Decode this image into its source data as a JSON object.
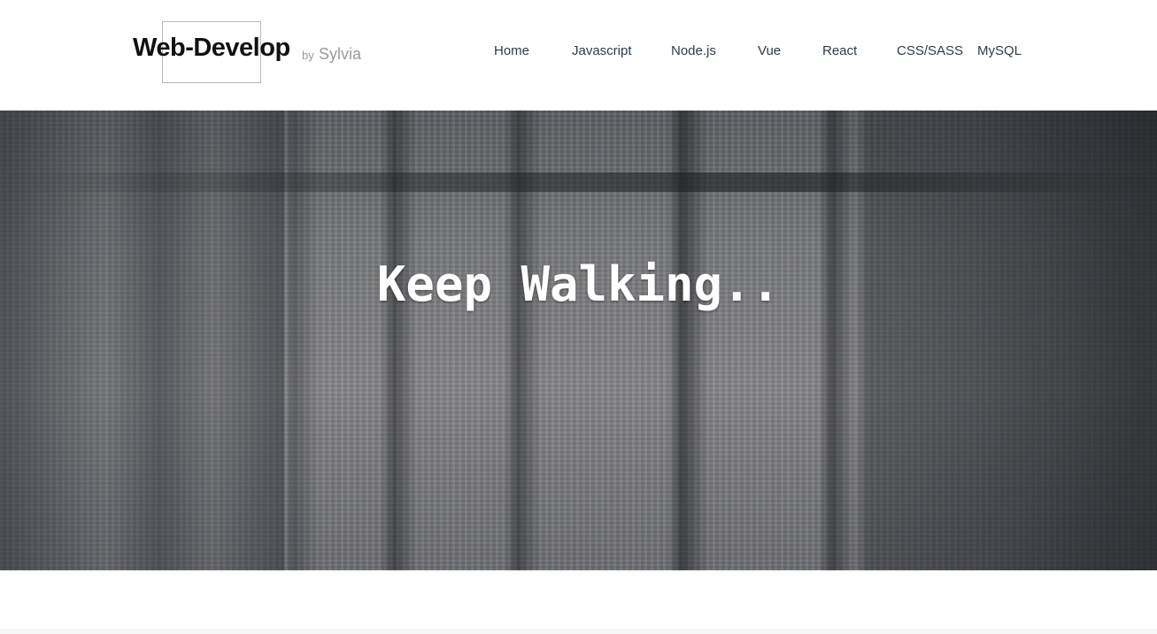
{
  "header": {
    "logo_title": "Web-Develop",
    "logo_by": "by",
    "logo_author": "Sylvia"
  },
  "nav": {
    "items": [
      {
        "label": "Home"
      },
      {
        "label": "Javascript"
      },
      {
        "label": "Node.js"
      },
      {
        "label": "Vue"
      },
      {
        "label": "React"
      },
      {
        "label": "CSS/SASS"
      },
      {
        "label": "MySQL"
      }
    ]
  },
  "hero": {
    "title": "Keep Walking.."
  },
  "colors": {
    "text_dark": "#111111",
    "nav_text": "#2f3b47",
    "muted": "#9a9a9a",
    "hero_text": "#ffffff"
  }
}
